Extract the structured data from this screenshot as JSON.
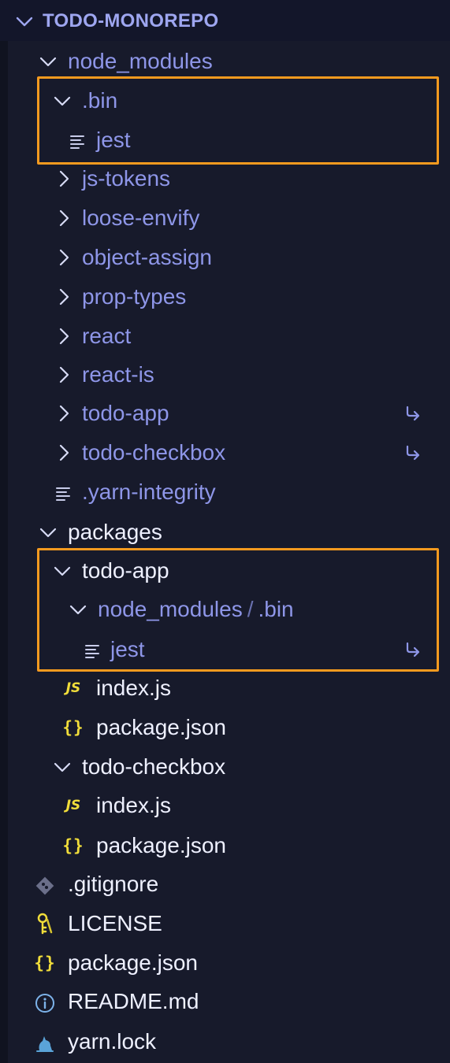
{
  "explorer": {
    "title": "TODO-MONOREPO",
    "rows": [
      {
        "label": "node_modules"
      },
      {
        "label": ".bin"
      },
      {
        "label": "jest"
      },
      {
        "label": "js-tokens"
      },
      {
        "label": "loose-envify"
      },
      {
        "label": "object-assign"
      },
      {
        "label": "prop-types"
      },
      {
        "label": "react"
      },
      {
        "label": "react-is"
      },
      {
        "label": "todo-app"
      },
      {
        "label": "todo-checkbox"
      },
      {
        "label": ".yarn-integrity"
      },
      {
        "label": "packages"
      },
      {
        "label": "todo-app"
      },
      {
        "label": "node_modules",
        "sep": "/",
        "label2": ".bin"
      },
      {
        "label": "jest"
      },
      {
        "label": "index.js"
      },
      {
        "label": "package.json"
      },
      {
        "label": "todo-checkbox"
      },
      {
        "label": "index.js"
      },
      {
        "label": "package.json"
      },
      {
        "label": ".gitignore"
      },
      {
        "label": "LICENSE"
      },
      {
        "label": "package.json"
      },
      {
        "label": "README.md"
      },
      {
        "label": "yarn.lock"
      }
    ],
    "icons": {
      "js": "JS",
      "json": "{}"
    }
  },
  "colors": {
    "background": "#171a2b",
    "highlight": "#f49a1f",
    "dim_text": "#8e96e8",
    "bright_text": "#eef0ff",
    "js_icon": "#f1dd3a"
  }
}
